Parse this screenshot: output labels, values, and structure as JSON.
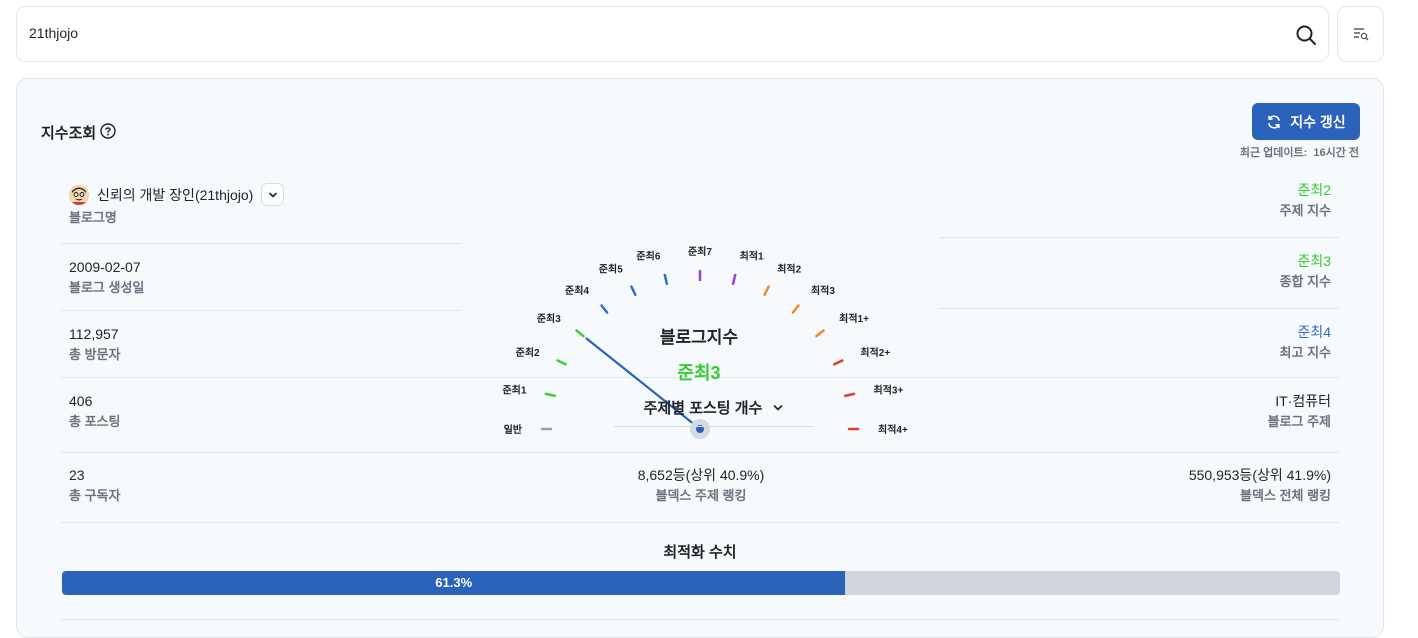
{
  "search": {
    "value": "21thjojo"
  },
  "panel": {
    "title": "지수조회",
    "refresh_label": "지수 갱신",
    "update_label": "최근 업데이트:",
    "update_value": "16시간 전"
  },
  "blog": {
    "name": "신뢰의 개발 장인(21thjojo)",
    "name_label": "블로그명",
    "created": "2009-02-07",
    "created_label": "블로그 생성일",
    "visitors": "112,957",
    "visitors_label": "총 방문자",
    "posts": "406",
    "posts_label": "총 포스팅",
    "subscribers": "23",
    "subscribers_label": "총 구독자"
  },
  "indices": {
    "topic_index": "준최2",
    "topic_index_label": "주제 지수",
    "total_index": "준최3",
    "total_index_label": "종합 지수",
    "max_index": "준최4",
    "max_index_label": "최고 지수",
    "blog_topic": "IT·컴퓨터",
    "blog_topic_label": "블로그 주제"
  },
  "gauge": {
    "title": "블로그지수",
    "value": "준최3",
    "levels": [
      "일반",
      "준최1",
      "준최2",
      "준최3",
      "준최4",
      "준최5",
      "준최6",
      "준최7",
      "최적1",
      "최적2",
      "최적3",
      "최적1+",
      "최적2+",
      "최적3+",
      "최적4+"
    ],
    "level_colors": [
      "#9aa0a6",
      "#39d039",
      "#39d039",
      "#39d039",
      "#2e6ec6",
      "#2e6ec6",
      "#2e6ec6",
      "#9b3fd6",
      "#9b3fd6",
      "#f08a24",
      "#f08a24",
      "#f08a24",
      "#e53935",
      "#e53935",
      "#e53935"
    ],
    "needle_level": 3
  },
  "topic_select": {
    "label": "주제별 포스팅 개수"
  },
  "ranking": {
    "topic_rank": "8,652등(상위 40.9%)",
    "topic_rank_label": "블덱스 주제 랭킹",
    "total_rank": "550,953등(상위 41.9%)",
    "total_rank_label": "블덱스 전체 랭킹"
  },
  "optimization": {
    "title": "최적화 수치",
    "percent_label": "61.3%",
    "percent": 61.3
  }
}
